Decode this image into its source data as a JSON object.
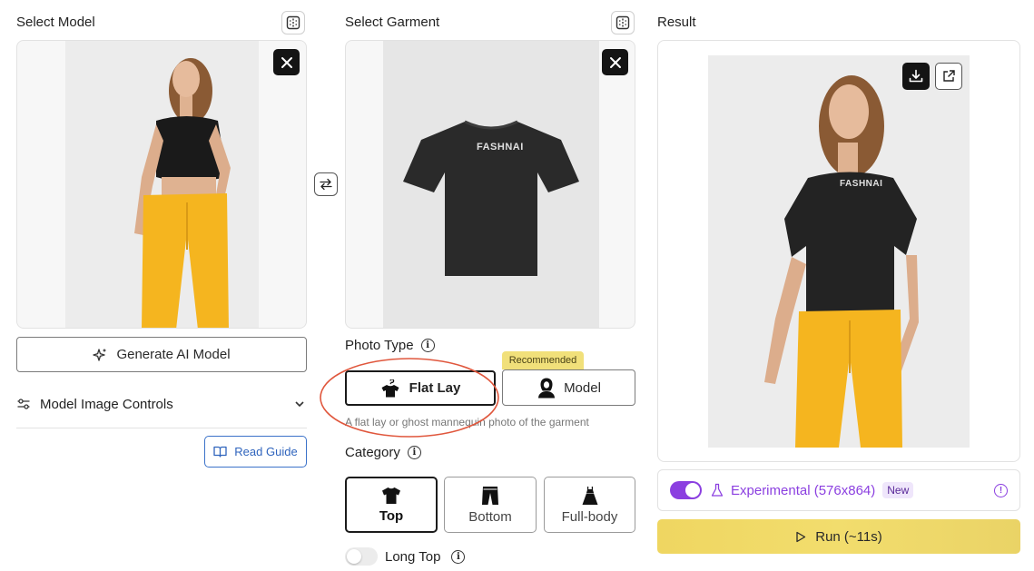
{
  "model_col": {
    "title": "Select Model",
    "generate_label": "Generate AI Model",
    "controls_label": "Model Image Controls",
    "guide_label": "Read Guide"
  },
  "garment_col": {
    "title": "Select Garment",
    "garment_brand_text": "FASHNAI",
    "photo_type_label": "Photo Type",
    "recommended_badge": "Recommended",
    "flat_lay_label": "Flat Lay",
    "model_option_label": "Model",
    "photo_type_hint": "A flat lay or ghost mannequin photo of the garment",
    "category_label": "Category",
    "categories": [
      {
        "label": "Top",
        "selected": true
      },
      {
        "label": "Bottom",
        "selected": false
      },
      {
        "label": "Full-body",
        "selected": false
      }
    ],
    "long_top_label": "Long Top"
  },
  "result_col": {
    "title": "Result",
    "shirt_brand_text": "FASHNAI",
    "experimental_label": "Experimental (576x864)",
    "new_badge": "New",
    "run_label": "Run (~11s)"
  },
  "colors": {
    "accent_purple": "#8b3fe0",
    "run_yellow": "#f2dc6a",
    "annotation_red": "#e0573d",
    "badge_yellow": "#f1e07a",
    "pants_yellow": "#f5b51f"
  }
}
